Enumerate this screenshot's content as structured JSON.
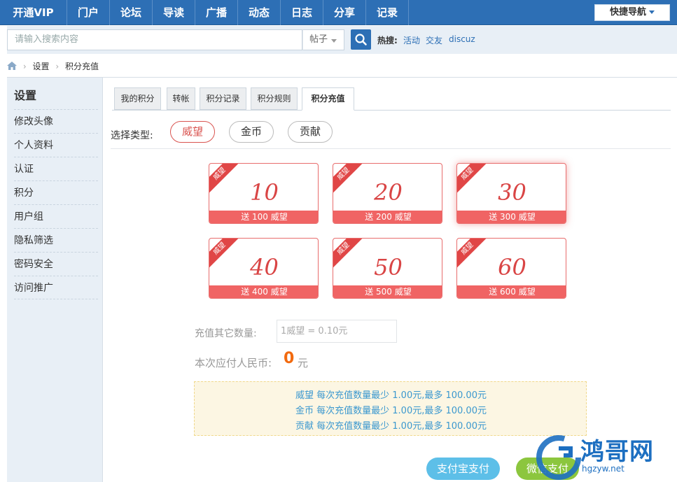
{
  "nav": {
    "items": [
      "开通VIP",
      "门户",
      "论坛",
      "导读",
      "广播",
      "动态",
      "日志",
      "分享",
      "记录"
    ],
    "quick_nav": "快捷导航"
  },
  "search": {
    "placeholder": "请输入搜索内容",
    "type": "帖子",
    "hot_label": "热搜:",
    "hot_links": [
      "活动",
      "交友",
      "discuz"
    ]
  },
  "breadcrumb": [
    "设置",
    "积分充值"
  ],
  "sidebar": {
    "title": "设置",
    "items": [
      "修改头像",
      "个人资料",
      "认证",
      "积分",
      "用户组",
      "隐私筛选",
      "密码安全",
      "访问推广"
    ]
  },
  "tabs": [
    "我的积分",
    "转帐",
    "积分记录",
    "积分规则",
    "积分充值"
  ],
  "active_tab": "积分充值",
  "type_select": {
    "label": "选择类型:",
    "options": [
      "威望",
      "金币",
      "贡献"
    ],
    "selected": "威望"
  },
  "cards": [
    {
      "ribbon": "威望",
      "amount": "10",
      "gift": "送 100 威望"
    },
    {
      "ribbon": "威望",
      "amount": "20",
      "gift": "送 200 威望"
    },
    {
      "ribbon": "威望",
      "amount": "30",
      "gift": "送 300 威望"
    },
    {
      "ribbon": "威望",
      "amount": "40",
      "gift": "送 400 威望"
    },
    {
      "ribbon": "威望",
      "amount": "50",
      "gift": "送 500 威望"
    },
    {
      "ribbon": "威望",
      "amount": "60",
      "gift": "送 600 威望"
    }
  ],
  "other": {
    "label": "充值其它数量:",
    "placeholder": "1威望 = 0.10元"
  },
  "pay": {
    "label": "本次应付人民币:",
    "amount": "0",
    "unit": "元"
  },
  "notes": [
    "威望 每次充值数量最少 1.00元,最多 100.00元",
    "金币 每次充值数量最少 1.00元,最多 100.00元",
    "贡献 每次充值数量最少 1.00元,最多 100.00元"
  ],
  "buttons": {
    "alipay": "支付宝支付",
    "wechat": "微信支付"
  },
  "watermark": {
    "title": "鸿哥网",
    "url": "hgzyw.net"
  },
  "colors": {
    "nav_bg": "#2d6fb5",
    "card_red": "#f06464",
    "pay_orange": "#f26a0f",
    "alipay_blue": "#5dbfe8",
    "wechat_green": "#8cc63e"
  }
}
